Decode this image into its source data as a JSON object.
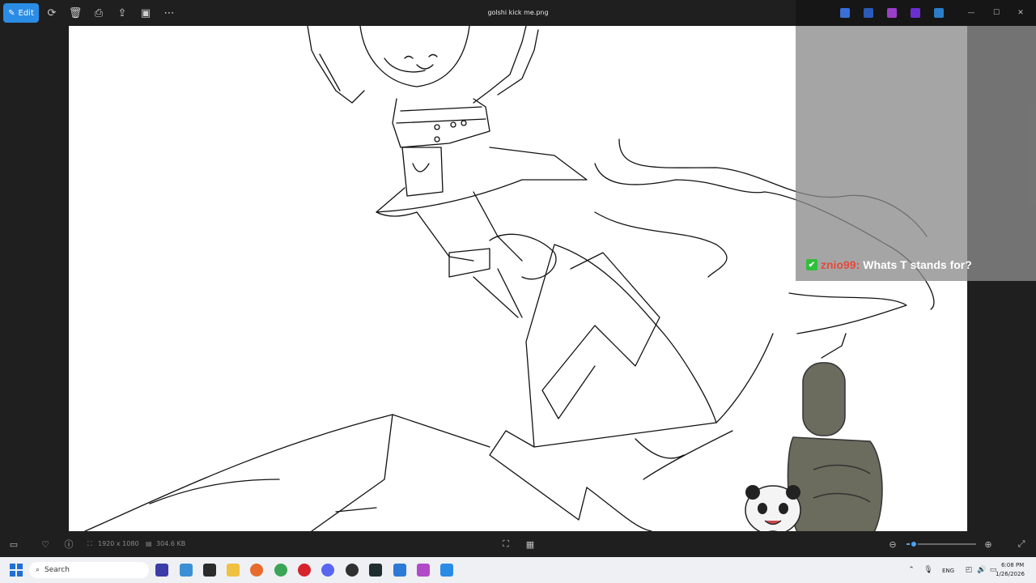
{
  "toolbar": {
    "edit_label": "Edit",
    "title": "golshi kick me.png"
  },
  "icons": [
    "rotate-icon",
    "delete-icon",
    "print-icon",
    "share-icon",
    "slideshow-icon",
    "more-icon"
  ],
  "chat": {
    "username": "znio99:",
    "message": "Whats T stands for?"
  },
  "status": {
    "dimensions": "1920 x 1080",
    "file_size": "304.6 KB",
    "zoom_fraction": 0.1
  },
  "taskbar": {
    "search_placeholder": "Search",
    "language": "ENG",
    "time": "6:08 PM",
    "date": "1/26/2026"
  },
  "colors": {
    "accent": "#2b8ce6",
    "chat_user": "#e44a3a",
    "chat_badge": "#2fbf3a"
  }
}
